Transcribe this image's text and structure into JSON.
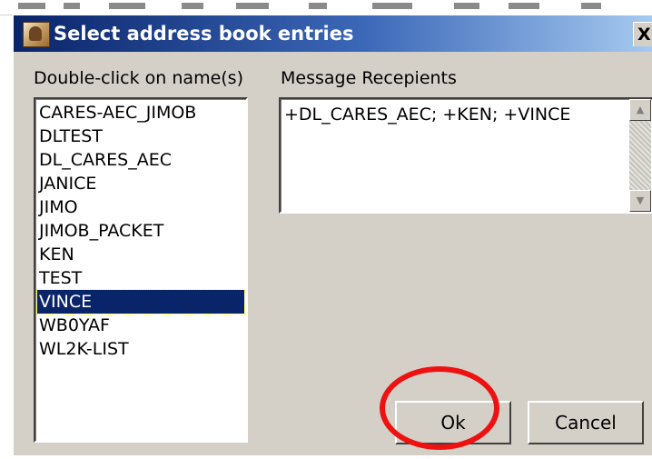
{
  "dialog": {
    "title": "Select address book entries",
    "close_glyph": "X"
  },
  "names": {
    "label": "Double-click on name(s)",
    "items": [
      "CARES-AEC_JIMOB",
      "DLTEST",
      "DL_CARES_AEC",
      "JANICE",
      "JIMO",
      "JIMOB_PACKET",
      "KEN",
      "TEST",
      "VINCE",
      "WB0YAF",
      "WL2K-LIST"
    ],
    "selected": "VINCE"
  },
  "recipients": {
    "label": "Message Recepients",
    "value": "+DL_CARES_AEC; +KEN; +VINCE",
    "scroll_up_glyph": "▲",
    "scroll_down_glyph": "▼"
  },
  "buttons": {
    "ok": "Ok",
    "cancel": "Cancel"
  },
  "colors": {
    "title_bar_start": "#0a246a",
    "title_bar_end": "#a6caf0",
    "dialog_face": "#d4d0c8",
    "selection": "#0a246a",
    "annotation_circle": "#ee1111"
  },
  "icons": {
    "title": "address-book-icon",
    "close": "close-icon",
    "scroll_up": "scroll-up-arrow-icon",
    "scroll_down": "scroll-down-arrow-icon"
  }
}
